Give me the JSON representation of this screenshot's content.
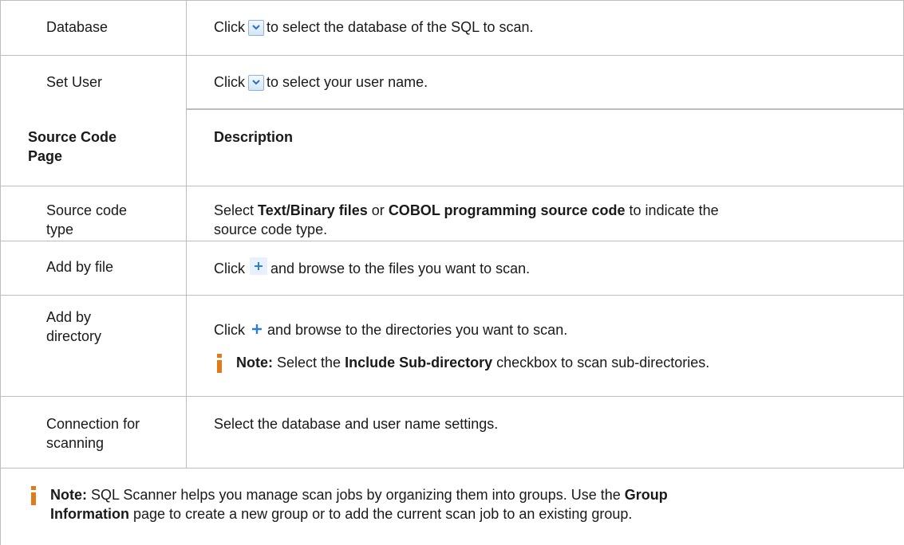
{
  "rows": [
    {
      "term": "Database",
      "parts": [
        "Click",
        "to select the database of the SQL to scan."
      ]
    },
    {
      "term": "Set User",
      "parts": [
        "Click",
        "to select your user name."
      ]
    }
  ],
  "source_header": {
    "col1_line1": "Source Code",
    "col1_line2": "Page",
    "col2": "Description"
  },
  "source_rows": {
    "type": {
      "term_line1": "Source code",
      "term_line2": "type",
      "pre": "Select",
      "bold1": "Text/Binary files",
      "mid": "or",
      "bold2": "COBOL programming source code",
      "post1": "to indicate the",
      "line2": "source code type."
    },
    "file": {
      "term": "Add by file",
      "pre": "Click",
      "post": "and browse to the files you want to scan."
    },
    "dir": {
      "term_line1": "Add by",
      "term_line2": "directory",
      "pre": "Click",
      "post": "and browse to the directories you want to scan.",
      "note_label": "Note:",
      "note_pre": "Select the",
      "note_bold": "Include Sub-directory",
      "note_post": "checkbox to scan sub-directories."
    },
    "conn": {
      "term_line1": "Connection for",
      "term_line2": "scanning",
      "desc": "Select the database and user name settings."
    }
  },
  "bottom_note": {
    "label": "Note:",
    "line1_pre": "SQL Scanner helps you manage scan jobs by organizing them into groups. Use the",
    "line1_bold": "Group",
    "line2_bold": "Information",
    "line2_post": "page to create a new group or to add the current scan job to an existing group."
  },
  "icons": {
    "dropdown": "chevron-down-icon",
    "add": "plus-icon",
    "note": "info-icon"
  },
  "colors": {
    "border": "#bdbdbd",
    "note_icon": "#e07b1a",
    "plus": "#2f7fd1",
    "dropdown_border": "#8fb3d9"
  }
}
